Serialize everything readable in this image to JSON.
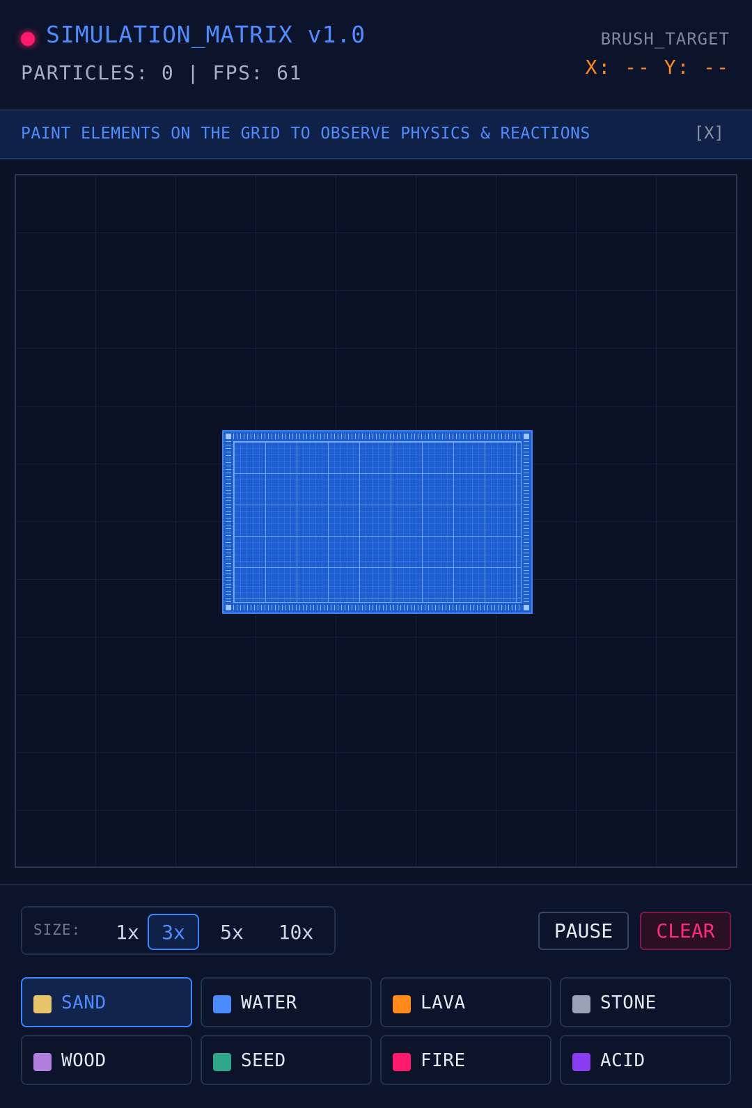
{
  "header": {
    "title": "SIMULATION_MATRIX v1.0",
    "stats": "PARTICLES: 0 | FPS: 61",
    "brush_label": "BRUSH_TARGET",
    "brush_coords": "X: -- Y: --",
    "status_dot_color": "#ff1a6b"
  },
  "banner": {
    "text": "PAINT ELEMENTS ON THE GRID TO OBSERVE PHYSICS & REACTIONS",
    "close_label": "[X]"
  },
  "controls": {
    "size_label": "SIZE:",
    "sizes": [
      "1x",
      "3x",
      "5x",
      "10x"
    ],
    "active_size": "3x",
    "pause_label": "PAUSE",
    "clear_label": "CLEAR"
  },
  "elements": [
    {
      "label": "SAND",
      "color": "#e9c46a",
      "active": true
    },
    {
      "label": "WATER",
      "color": "#4a8bff",
      "active": false
    },
    {
      "label": "LAVA",
      "color": "#ff8a1a",
      "active": false
    },
    {
      "label": "STONE",
      "color": "#9aa3b5",
      "active": false
    },
    {
      "label": "WOOD",
      "color": "#b07fe0",
      "active": false
    },
    {
      "label": "SEED",
      "color": "#2fa88a",
      "active": false
    },
    {
      "label": "FIRE",
      "color": "#ff1a6b",
      "active": false
    },
    {
      "label": "ACID",
      "color": "#8a3cf0",
      "active": false
    }
  ]
}
